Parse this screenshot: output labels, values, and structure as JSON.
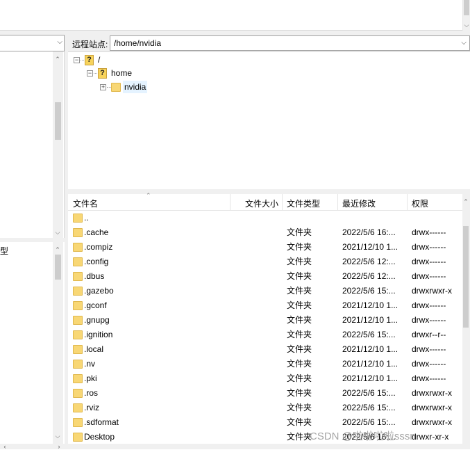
{
  "colors": {
    "folder": "#f8d775",
    "selection": "#e5f3ff",
    "pane_bg": "#f0f0f0",
    "scroll_thumb": "#cdcdcd"
  },
  "local": {
    "header_fragment": "型"
  },
  "remote": {
    "label": "远程站点:",
    "path": "/home/nvidia",
    "tree": [
      {
        "name": "/",
        "icon": "question-folder-icon",
        "expanded": true
      },
      {
        "name": "home",
        "icon": "question-folder-icon",
        "expanded": true
      },
      {
        "name": "nvidia",
        "icon": "folder-icon",
        "expanded": false,
        "selected": true
      }
    ],
    "columns": {
      "name": "文件名",
      "size": "文件大小",
      "type": "文件类型",
      "modified": "最近修改",
      "perm": "权限"
    },
    "files": [
      {
        "name": "..",
        "type": "",
        "modified": "",
        "perm": ""
      },
      {
        "name": ".cache",
        "type": "文件夹",
        "modified": "2022/5/6 16:...",
        "perm": "drwx------"
      },
      {
        "name": ".compiz",
        "type": "文件夹",
        "modified": "2021/12/10 1...",
        "perm": "drwx------"
      },
      {
        "name": ".config",
        "type": "文件夹",
        "modified": "2022/5/6 12:...",
        "perm": "drwx------"
      },
      {
        "name": ".dbus",
        "type": "文件夹",
        "modified": "2022/5/6 12:...",
        "perm": "drwx------"
      },
      {
        "name": ".gazebo",
        "type": "文件夹",
        "modified": "2022/5/6 15:...",
        "perm": "drwxrwxr-x"
      },
      {
        "name": ".gconf",
        "type": "文件夹",
        "modified": "2021/12/10 1...",
        "perm": "drwx------"
      },
      {
        "name": ".gnupg",
        "type": "文件夹",
        "modified": "2021/12/10 1...",
        "perm": "drwx------"
      },
      {
        "name": ".ignition",
        "type": "文件夹",
        "modified": "2022/5/6 15:...",
        "perm": "drwxr--r--"
      },
      {
        "name": ".local",
        "type": "文件夹",
        "modified": "2021/12/10 1...",
        "perm": "drwx------"
      },
      {
        "name": ".nv",
        "type": "文件夹",
        "modified": "2021/12/10 1...",
        "perm": "drwx------"
      },
      {
        "name": ".pki",
        "type": "文件夹",
        "modified": "2021/12/10 1...",
        "perm": "drwx------"
      },
      {
        "name": ".ros",
        "type": "文件夹",
        "modified": "2022/5/6 15:...",
        "perm": "drwxrwxr-x"
      },
      {
        "name": ".rviz",
        "type": "文件夹",
        "modified": "2022/5/6 15:...",
        "perm": "drwxrwxr-x"
      },
      {
        "name": ".sdformat",
        "type": "文件夹",
        "modified": "2022/5/6 15:...",
        "perm": "drwxrwxr-x"
      },
      {
        "name": "Desktop",
        "type": "文件夹",
        "modified": "2022/5/6 16:...",
        "perm": "drwxr-xr-x"
      }
    ]
  },
  "watermark": "CSDN @啦啦啦啦sssn"
}
